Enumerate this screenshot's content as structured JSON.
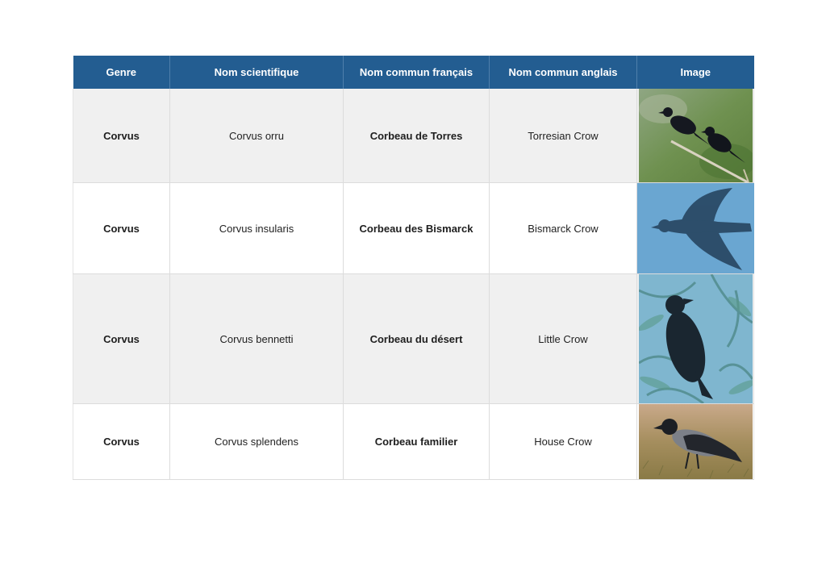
{
  "headers": {
    "genre": "Genre",
    "scientific": "Nom scientifique",
    "french": "Nom commun français",
    "english": "Nom commun anglais",
    "image": "Image"
  },
  "rows": [
    {
      "genre": "Corvus",
      "scientific": "Corvus orru",
      "french": "Corbeau de Torres",
      "english": "Torresian Crow",
      "image_icon": "two-crows-on-branch-photo"
    },
    {
      "genre": "Corvus",
      "scientific": "Corvus insularis",
      "french": "Corbeau des Bismarck",
      "english": "Bismarck Crow",
      "image_icon": "crow-in-flight-photo"
    },
    {
      "genre": "Corvus",
      "scientific": "Corvus bennetti",
      "french": "Corbeau du désert",
      "english": "Little Crow",
      "image_icon": "crow-in-tree-photo"
    },
    {
      "genre": "Corvus",
      "scientific": "Corvus splendens",
      "french": "Corbeau familier",
      "english": "House Crow",
      "image_icon": "crow-on-ground-photo"
    }
  ],
  "colors": {
    "header_bg": "#235d91",
    "row_alt_bg": "#f0f0f0"
  }
}
